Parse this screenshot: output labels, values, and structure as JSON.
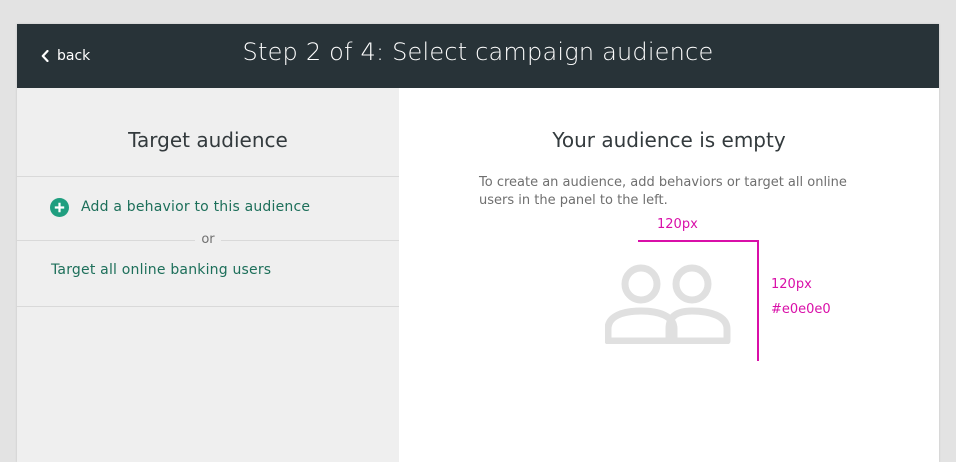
{
  "header": {
    "back_label": "back",
    "title": "Step 2 of 4: Select campaign audience"
  },
  "sidebar": {
    "title": "Target audience",
    "add_behavior_label": "Add a behavior to this audience",
    "or_label": "or",
    "target_all_label": "Target all online banking users"
  },
  "main": {
    "empty_title": "Your audience is empty",
    "empty_description": "To create an audience, add behaviors or target all online users in the panel to the left.",
    "icon": "people-icon",
    "annotations": {
      "width_label": "120px",
      "height_label": "120px",
      "color_label": "#e0e0e0"
    }
  },
  "colors": {
    "header_bg": "#283338",
    "sidebar_bg": "#efefef",
    "accent_green": "#1d6f5a",
    "add_icon_green": "#1f9e7f",
    "annotation_magenta": "#d90fa8",
    "icon_gray": "#e0e0e0"
  }
}
